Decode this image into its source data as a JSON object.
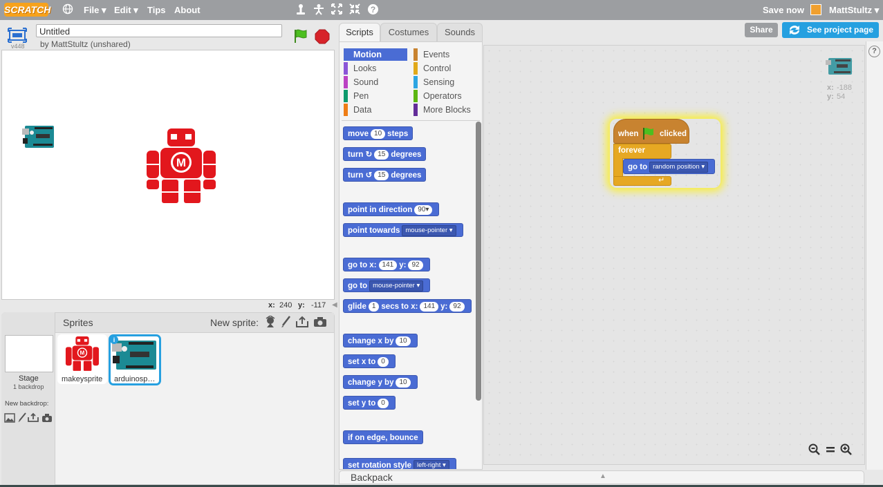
{
  "topbar": {
    "logo": "SCRATCH",
    "menus": [
      "File ▾",
      "Edit ▾",
      "Tips",
      "About"
    ],
    "save_now": "Save now",
    "user": "MattStultz ▾"
  },
  "stage": {
    "title": "Untitled",
    "byline": "by MattStultz (unshared)",
    "version": "v448",
    "mouse_x_label": "x:",
    "mouse_x": "240",
    "mouse_y_label": "y:",
    "mouse_y": "-117"
  },
  "sprites_pane": {
    "title": "Sprites",
    "new_sprite": "New sprite:",
    "stage_label": "Stage",
    "stage_sub": "1 backdrop",
    "new_backdrop": "New backdrop:",
    "sprites": [
      {
        "name": "makeysprite",
        "selected": false
      },
      {
        "name": "arduinosp…",
        "selected": true
      }
    ]
  },
  "tabs": [
    "Scripts",
    "Costumes",
    "Sounds"
  ],
  "header_buttons": {
    "share": "Share",
    "see_project": "See project page"
  },
  "categories": [
    {
      "label": "Motion",
      "color": "#4a6cd4",
      "active": true
    },
    {
      "label": "Events",
      "color": "#c88330"
    },
    {
      "label": "Looks",
      "color": "#8a55d7"
    },
    {
      "label": "Control",
      "color": "#e1a91a"
    },
    {
      "label": "Sound",
      "color": "#bb42c3"
    },
    {
      "label": "Sensing",
      "color": "#2ca5e2"
    },
    {
      "label": "Pen",
      "color": "#0e9a6c"
    },
    {
      "label": "Operators",
      "color": "#5cb712"
    },
    {
      "label": "Data",
      "color": "#ee7d16"
    },
    {
      "label": "More Blocks",
      "color": "#632d99"
    }
  ],
  "blocks": {
    "move": {
      "a": "move",
      "n": "10",
      "b": "steps"
    },
    "turn_cw": {
      "a": "turn",
      "n": "15",
      "b": "degrees"
    },
    "turn_ccw": {
      "a": "turn",
      "n": "15",
      "b": "degrees"
    },
    "point_dir": {
      "a": "point in direction",
      "n": "90▾"
    },
    "point_towards": {
      "a": "point towards",
      "d": "mouse-pointer ▾"
    },
    "goto_xy": {
      "a": "go to x:",
      "n1": "141",
      "b": "y:",
      "n2": "92"
    },
    "goto": {
      "a": "go to",
      "d": "mouse-pointer ▾"
    },
    "glide": {
      "a": "glide",
      "n1": "1",
      "b": "secs to x:",
      "n2": "141",
      "c": "y:",
      "n3": "92"
    },
    "change_x": {
      "a": "change x by",
      "n": "10"
    },
    "set_x": {
      "a": "set x to",
      "n": "0"
    },
    "change_y": {
      "a": "change y by",
      "n": "10"
    },
    "set_y": {
      "a": "set y to",
      "n": "0"
    },
    "bounce": {
      "a": "if on edge, bounce"
    },
    "rotation": {
      "a": "set rotation style",
      "d": "left-right ▾"
    }
  },
  "script": {
    "hat_when": "when",
    "hat_clicked": "clicked",
    "forever": "forever",
    "goto": "go to",
    "goto_dd": "random position ▾"
  },
  "sprite_info": {
    "x_label": "x:",
    "x": "-188",
    "y_label": "y:",
    "y": "54"
  },
  "backpack": "Backpack",
  "colors": {
    "topbar": "#9c9ea1",
    "motion": "#4a6cd4",
    "control": "#e6a823",
    "events": "#c88330",
    "share_blue": "#25a0e0"
  }
}
